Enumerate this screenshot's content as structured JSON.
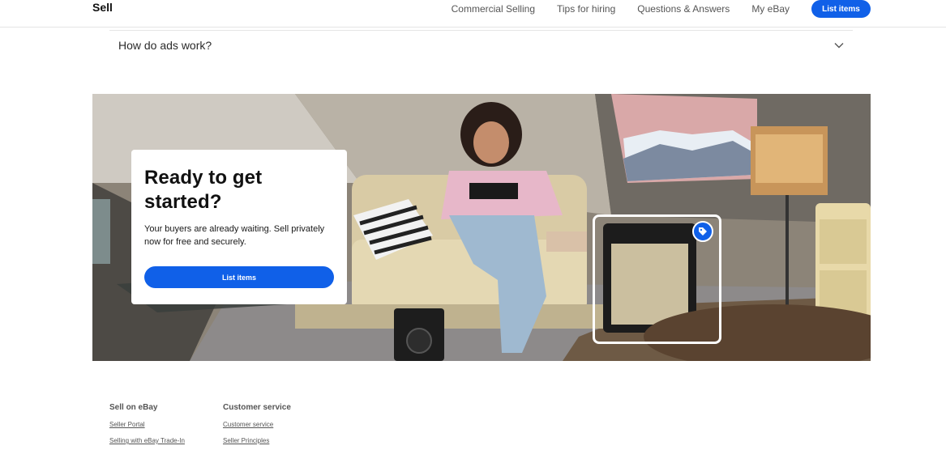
{
  "header": {
    "brand": "Sell",
    "nav": [
      "Commercial Selling",
      "Tips for hiring",
      "Questions & Answers",
      "My eBay"
    ],
    "cta_label": "List items"
  },
  "faq": {
    "question": "How do ads work?",
    "icon": "chevron-down-icon"
  },
  "hero": {
    "title": "Ready to get started?",
    "body": "Your buyers are already waiting. Sell privately now for free and securely.",
    "cta_label": "List items",
    "badge_icon": "tag-icon",
    "colors": {
      "accent": "#1060e8"
    }
  },
  "footer": {
    "columns": [
      {
        "heading": "Sell on eBay",
        "links": [
          "Seller Portal",
          "Selling with eBay Trade-In"
        ]
      },
      {
        "heading": "Customer service",
        "links": [
          "Customer service",
          "Seller Principles"
        ]
      }
    ]
  }
}
